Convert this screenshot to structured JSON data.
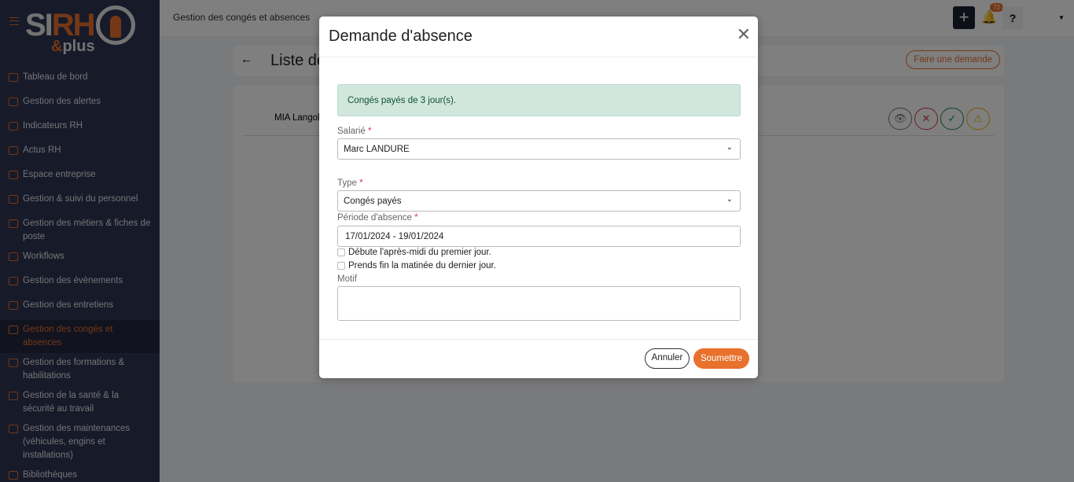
{
  "brand": {
    "logo_main": "SIRH",
    "logo_sub": "&plus"
  },
  "sidebar": {
    "items": [
      {
        "label": "Tableau de bord"
      },
      {
        "label": "Gestion des alertes"
      },
      {
        "label": "Indicateurs RH"
      },
      {
        "label": "Actus RH"
      },
      {
        "label": "Espace entreprise"
      },
      {
        "label": "Gestion & suivi du personnel"
      },
      {
        "label": "Gestion des métiers & fiches de poste"
      },
      {
        "label": "Workflows"
      },
      {
        "label": "Gestion des évènements"
      },
      {
        "label": "Gestion des entretiens"
      },
      {
        "label": "Gestion des congés et absences",
        "active": true
      },
      {
        "label": "Gestion des formations & habilitations"
      },
      {
        "label": "Gestion de la santé & la sécurité au travail"
      },
      {
        "label": "Gestion des maintenances (véhicules, engins et installations)"
      },
      {
        "label": "Bibliothèques"
      }
    ]
  },
  "topbar": {
    "title": "Gestion des congés et absences",
    "notifications": "72",
    "help": "?"
  },
  "page": {
    "title": "Liste des demandes",
    "cta": "Faire une demande",
    "row_name": "MIA Langolf"
  },
  "modal": {
    "title": "Demande d'absence",
    "alert": "Congés payés de 3 jour(s).",
    "employee_label": "Salarié",
    "employee_value": "Marc LANDURE",
    "type_label": "Type",
    "type_value": "Congés payés",
    "period_label": "Période d'absence",
    "period_value": "17/01/2024 - 19/01/2024",
    "check1": "Débute l'après-midi du premier jour.",
    "check2": "Prends fin la matinée du dernier jour.",
    "motif_label": "Motif",
    "required": "*",
    "cancel": "Annuler",
    "submit": "Soumettre"
  }
}
